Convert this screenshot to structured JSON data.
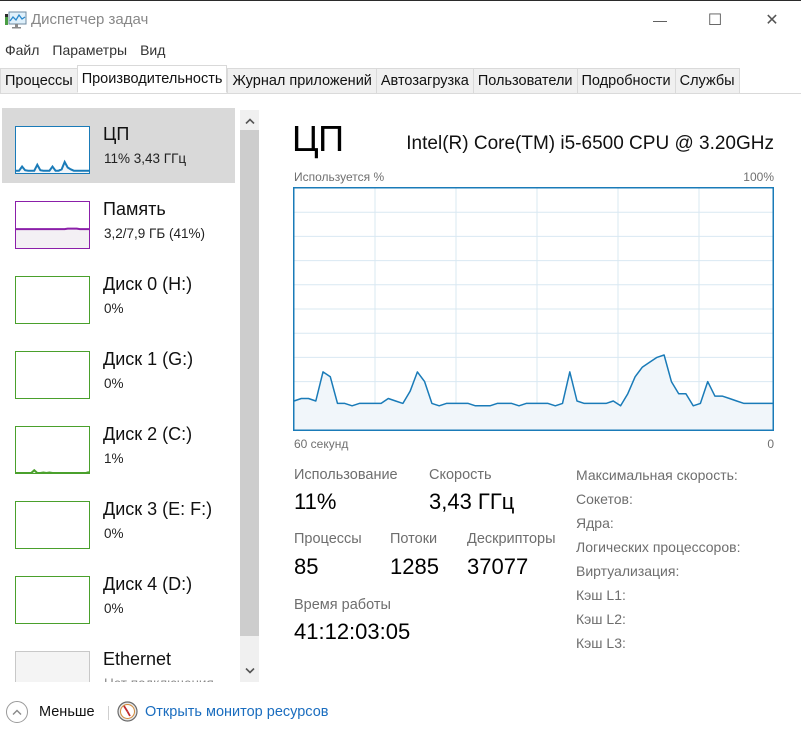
{
  "window": {
    "title": "Диспетчер задач",
    "icon": "task-manager-icon",
    "controls": {
      "minimize": "—",
      "maximize": "☐",
      "close": "✕"
    }
  },
  "menu": [
    "Файл",
    "Параметры",
    "Вид"
  ],
  "tabs": [
    {
      "label": "Процессы",
      "active": false
    },
    {
      "label": "Производительность",
      "active": true
    },
    {
      "label": "Журнал приложений",
      "active": false
    },
    {
      "label": "Автозагрузка",
      "active": false
    },
    {
      "label": "Пользователи",
      "active": false
    },
    {
      "label": "Подробности",
      "active": false
    },
    {
      "label": "Службы",
      "active": false
    }
  ],
  "sidebar": {
    "items": [
      {
        "name": "ЦП",
        "sub": "11% 3,43 ГГц",
        "color": "#1a7bb8",
        "fill": "#f1f6fa",
        "selected": true,
        "values": [
          5,
          5,
          14,
          6,
          5,
          5,
          5,
          18,
          6,
          5,
          5,
          5,
          14,
          5,
          5,
          8,
          24,
          12,
          8,
          5,
          5,
          5,
          5,
          5,
          5
        ]
      },
      {
        "name": "Память",
        "sub": "3,2/7,9 ГБ (41%)",
        "color": "#8b1fa9",
        "fill": "#f3f0f4",
        "selected": false,
        "values": [
          41,
          41,
          41,
          41,
          41,
          41,
          41,
          41,
          41,
          41,
          41,
          41,
          41,
          41,
          41,
          41,
          41,
          42,
          42,
          42,
          42,
          41,
          41,
          41,
          41
        ]
      },
      {
        "name": "Диск 0 (H:)",
        "sub": "0%",
        "color": "#4aa02c",
        "fill": "#eef6ea",
        "selected": false,
        "values": []
      },
      {
        "name": "Диск 1 (G:)",
        "sub": "0%",
        "color": "#4aa02c",
        "fill": "#eef6ea",
        "selected": false,
        "values": []
      },
      {
        "name": "Диск 2 (C:)",
        "sub": "1%",
        "color": "#4aa02c",
        "fill": "#eef6ea",
        "selected": false,
        "values": [
          0,
          0,
          0,
          0,
          0,
          0,
          6,
          0,
          0,
          1,
          0,
          1,
          0,
          0,
          0,
          0,
          0,
          0,
          0,
          0,
          0,
          0,
          0,
          0,
          2
        ]
      },
      {
        "name": "Диск 3 (E: F:)",
        "sub": "0%",
        "color": "#4aa02c",
        "fill": "#eef6ea",
        "selected": false,
        "values": []
      },
      {
        "name": "Диск 4 (D:)",
        "sub": "0%",
        "color": "#4aa02c",
        "fill": "#eef6ea",
        "selected": false,
        "values": []
      },
      {
        "name": "Ethernet",
        "sub": "Нет подключения",
        "color": "#c8c8c8",
        "fill": "#f4f4f4",
        "selected": false,
        "values": []
      }
    ]
  },
  "detail": {
    "title": "ЦП",
    "model": "Intel(R) Core(TM) i5-6500 CPU @ 3.20GHz",
    "graph_label_top_left": "Используется %",
    "graph_label_top_right": "100%",
    "graph_label_bottom_left": "60 секунд",
    "graph_label_bottom_right": "0",
    "stats": {
      "usage_label": "Использование",
      "usage_value": "11%",
      "speed_label": "Скорость",
      "speed_value": "3,43 ГГц",
      "processes_label": "Процессы",
      "processes_value": "85",
      "threads_label": "Потоки",
      "threads_value": "1285",
      "handles_label": "Дескрипторы",
      "handles_value": "37077",
      "uptime_label": "Время работы",
      "uptime_value": "41:12:03:05"
    },
    "specs": [
      "Максимальная скорость:",
      "Сокетов:",
      "Ядра:",
      "Логических процессоров:",
      "Виртуализация:",
      "Кэш L1:",
      "Кэш L2:",
      "Кэш L3:"
    ]
  },
  "footer": {
    "less_label": "Меньше",
    "monitor_label": "Открыть монитор ресурсов"
  },
  "colors": {
    "cpu_line": "#1a7bb8",
    "cpu_fill": "#f1f6fa",
    "grid": "#d9e8f2",
    "link": "#1a6dbf"
  },
  "chart_data": {
    "type": "area",
    "title": "ЦП — Используется %",
    "xlabel": "60 секунд",
    "ylabel": "Используется %",
    "xlim": [
      60,
      0
    ],
    "ylim": [
      0,
      100
    ],
    "grid": true,
    "series": [
      {
        "name": "ЦП",
        "values": [
          12,
          13,
          13,
          12,
          24,
          22,
          11,
          11,
          10,
          11,
          11,
          11,
          11,
          13,
          12,
          11,
          16,
          24,
          20,
          11,
          10,
          11,
          11,
          11,
          11,
          10,
          10,
          10,
          11,
          11,
          11,
          10,
          11,
          11,
          11,
          11,
          10,
          11,
          24,
          12,
          11,
          11,
          11,
          11,
          12,
          10,
          15,
          22,
          26,
          28,
          30,
          31,
          20,
          15,
          15,
          10,
          11,
          20,
          14,
          14,
          13,
          12,
          11,
          11,
          11,
          11,
          11
        ]
      }
    ]
  }
}
